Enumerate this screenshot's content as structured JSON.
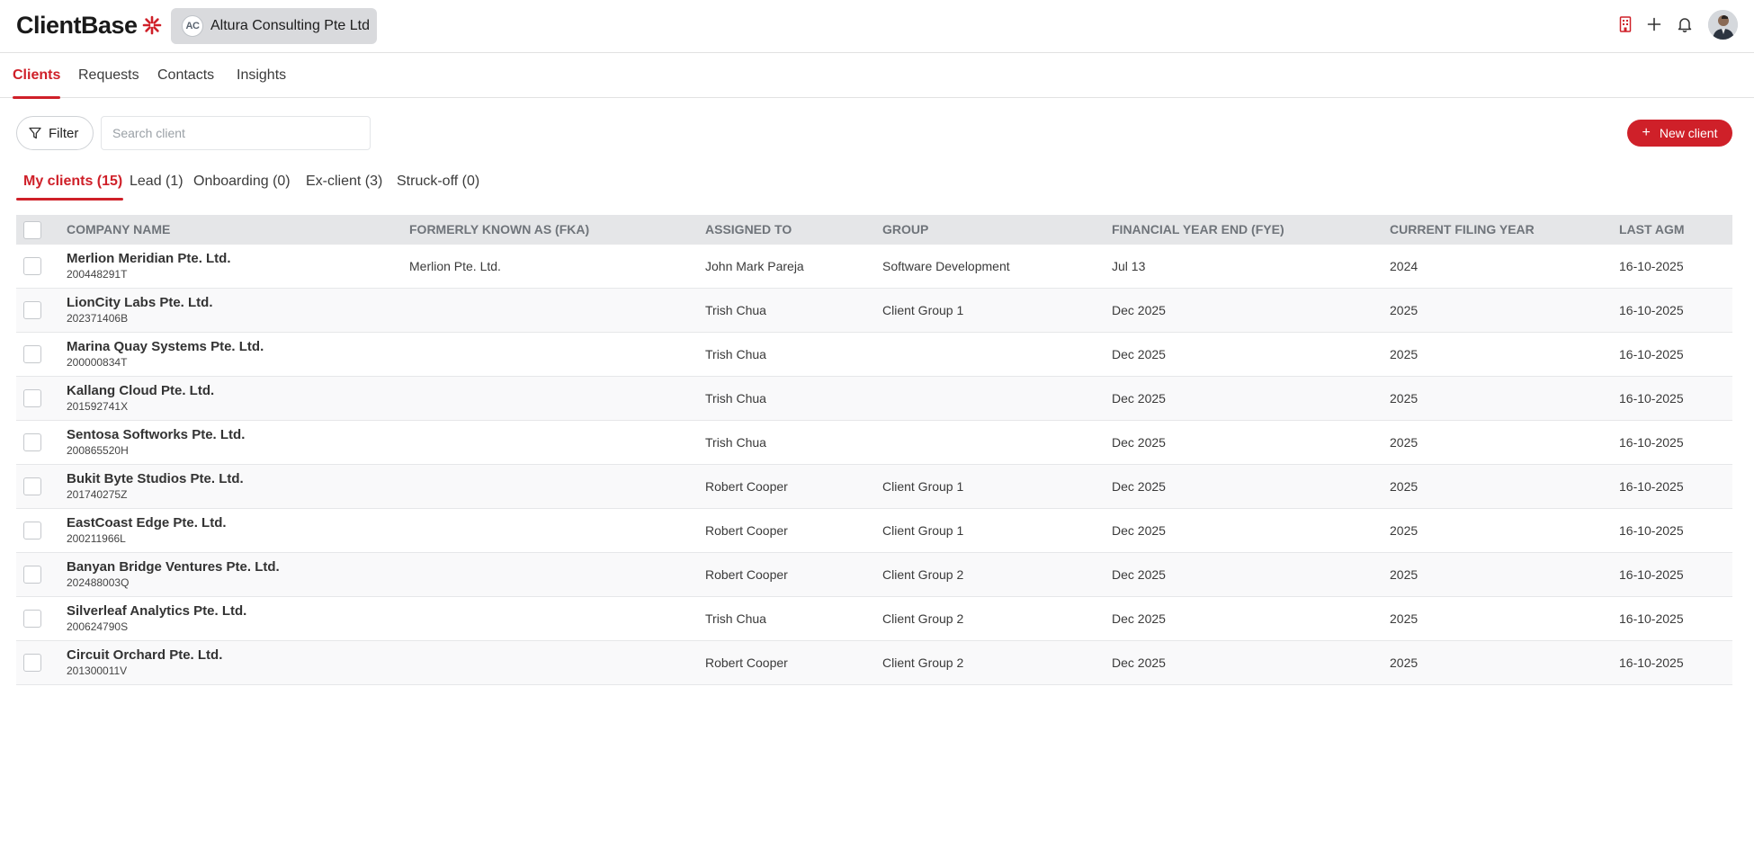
{
  "header": {
    "logo_text": "ClientBase",
    "org": {
      "initials": "AC",
      "name": "Altura Consulting Pte Ltd"
    },
    "icons": [
      "building-icon",
      "plus-icon",
      "bell-icon",
      "user-avatar"
    ],
    "accent_color": "#cf2029"
  },
  "nav": {
    "tabs": [
      {
        "label": "Clients",
        "active": true
      },
      {
        "label": "Requests",
        "active": false
      },
      {
        "label": "Contacts",
        "active": false
      },
      {
        "label": "Insights",
        "active": false
      }
    ]
  },
  "toolbar": {
    "filter_label": "Filter",
    "search_placeholder": "Search client",
    "search_value": "",
    "new_client_label": "New client"
  },
  "status_tabs": [
    {
      "label": "My clients (15)",
      "active": true
    },
    {
      "label": "Lead (1)",
      "active": false
    },
    {
      "label": "Onboarding (0)",
      "active": false
    },
    {
      "label": "Ex-client (3)",
      "active": false
    },
    {
      "label": "Struck-off (0)",
      "active": false
    }
  ],
  "table": {
    "columns": [
      "COMPANY NAME",
      "FORMERLY KNOWN AS (FKA)",
      "ASSIGNED TO",
      "GROUP",
      "FINANCIAL YEAR END (FYE)",
      "CURRENT FILING YEAR",
      "LAST AGM"
    ],
    "rows": [
      {
        "name": "Merlion Meridian Pte. Ltd.",
        "reg": "200448291T",
        "fka": "Merlion Pte. Ltd.",
        "assigned": "John Mark Pareja",
        "group": "Software Development",
        "fye": "Jul 13",
        "filing_year": "2024",
        "last_agm": "16-10-2025"
      },
      {
        "name": "LionCity Labs Pte. Ltd.",
        "reg": "202371406B",
        "fka": "",
        "assigned": "Trish Chua",
        "group": "Client Group 1",
        "fye": "Dec 2025",
        "filing_year": "2025",
        "last_agm": "16-10-2025"
      },
      {
        "name": "Marina Quay Systems Pte. Ltd.",
        "reg": "200000834T",
        "fka": "",
        "assigned": "Trish Chua",
        "group": "",
        "fye": "Dec 2025",
        "filing_year": "2025",
        "last_agm": "16-10-2025"
      },
      {
        "name": "Kallang Cloud Pte. Ltd.",
        "reg": "201592741X",
        "fka": "",
        "assigned": "Trish Chua",
        "group": "",
        "fye": "Dec 2025",
        "filing_year": "2025",
        "last_agm": "16-10-2025"
      },
      {
        "name": "Sentosa Softworks Pte. Ltd.",
        "reg": "200865520H",
        "fka": "",
        "assigned": "Trish Chua",
        "group": "",
        "fye": "Dec 2025",
        "filing_year": "2025",
        "last_agm": "16-10-2025"
      },
      {
        "name": "Bukit Byte Studios Pte. Ltd.",
        "reg": "201740275Z",
        "fka": "",
        "assigned": "Robert Cooper",
        "group": "Client Group 1",
        "fye": "Dec 2025",
        "filing_year": "2025",
        "last_agm": "16-10-2025"
      },
      {
        "name": "EastCoast Edge Pte. Ltd.",
        "reg": "200211966L",
        "fka": "",
        "assigned": "Robert Cooper",
        "group": "Client Group 1",
        "fye": "Dec 2025",
        "filing_year": "2025",
        "last_agm": "16-10-2025"
      },
      {
        "name": "Banyan Bridge Ventures Pte. Ltd.",
        "reg": "202488003Q",
        "fka": "",
        "assigned": "Robert Cooper",
        "group": "Client Group 2",
        "fye": "Dec 2025",
        "filing_year": "2025",
        "last_agm": "16-10-2025"
      },
      {
        "name": "Silverleaf Analytics Pte. Ltd.",
        "reg": "200624790S",
        "fka": "",
        "assigned": "Trish Chua",
        "group": "Client Group 2",
        "fye": "Dec 2025",
        "filing_year": "2025",
        "last_agm": "16-10-2025"
      },
      {
        "name": "Circuit Orchard Pte. Ltd.",
        "reg": "201300011V",
        "fka": "",
        "assigned": "Robert Cooper",
        "group": "Client Group 2",
        "fye": "Dec 2025",
        "filing_year": "2025",
        "last_agm": "16-10-2025"
      }
    ]
  }
}
